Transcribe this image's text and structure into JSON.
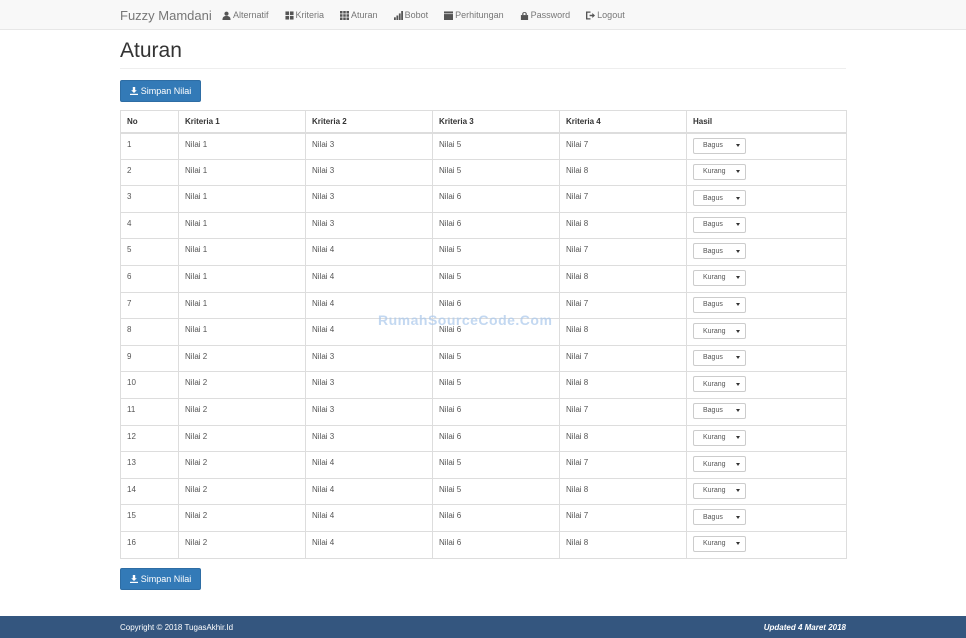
{
  "navbar": {
    "brand": "Fuzzy Mamdani",
    "items": [
      {
        "label": "Alternatif",
        "icon": "user-icon"
      },
      {
        "label": "Kriteria",
        "icon": "th-large-icon"
      },
      {
        "label": "Aturan",
        "icon": "th-icon"
      },
      {
        "label": "Bobot",
        "icon": "signal-icon"
      },
      {
        "label": "Perhitungan",
        "icon": "calendar-icon"
      },
      {
        "label": "Password",
        "icon": "lock-icon"
      },
      {
        "label": "Logout",
        "icon": "log-out-icon"
      }
    ]
  },
  "page": {
    "title": "Aturan"
  },
  "buttons": {
    "save_label": "Simpan Nilai"
  },
  "table": {
    "headers": [
      "No",
      "Kriteria 1",
      "Kriteria 2",
      "Kriteria 3",
      "Kriteria 4",
      "Hasil"
    ],
    "rows": [
      [
        "1",
        "Nilai 1",
        "Nilai 3",
        "Nilai 5",
        "Nilai 7",
        "Bagus"
      ],
      [
        "2",
        "Nilai 1",
        "Nilai 3",
        "Nilai 5",
        "Nilai 8",
        "Kurang"
      ],
      [
        "3",
        "Nilai 1",
        "Nilai 3",
        "Nilai 6",
        "Nilai 7",
        "Bagus"
      ],
      [
        "4",
        "Nilai 1",
        "Nilai 3",
        "Nilai 6",
        "Nilai 8",
        "Bagus"
      ],
      [
        "5",
        "Nilai 1",
        "Nilai 4",
        "Nilai 5",
        "Nilai 7",
        "Bagus"
      ],
      [
        "6",
        "Nilai 1",
        "Nilai 4",
        "Nilai 5",
        "Nilai 8",
        "Kurang"
      ],
      [
        "7",
        "Nilai 1",
        "Nilai 4",
        "Nilai 6",
        "Nilai 7",
        "Bagus"
      ],
      [
        "8",
        "Nilai 1",
        "Nilai 4",
        "Nilai 6",
        "Nilai 8",
        "Kurang"
      ],
      [
        "9",
        "Nilai 2",
        "Nilai 3",
        "Nilai 5",
        "Nilai 7",
        "Bagus"
      ],
      [
        "10",
        "Nilai 2",
        "Nilai 3",
        "Nilai 5",
        "Nilai 8",
        "Kurang"
      ],
      [
        "11",
        "Nilai 2",
        "Nilai 3",
        "Nilai 6",
        "Nilai 7",
        "Bagus"
      ],
      [
        "12",
        "Nilai 2",
        "Nilai 3",
        "Nilai 6",
        "Nilai 8",
        "Kurang"
      ],
      [
        "13",
        "Nilai 2",
        "Nilai 4",
        "Nilai 5",
        "Nilai 7",
        "Kurang"
      ],
      [
        "14",
        "Nilai 2",
        "Nilai 4",
        "Nilai 5",
        "Nilai 8",
        "Kurang"
      ],
      [
        "15",
        "Nilai 2",
        "Nilai 4",
        "Nilai 6",
        "Nilai 7",
        "Bagus"
      ],
      [
        "16",
        "Nilai 2",
        "Nilai 4",
        "Nilai 6",
        "Nilai 8",
        "Kurang"
      ]
    ]
  },
  "watermark": "RumahSourceCode.Com",
  "footer": {
    "copyright": "Copyright © 2018 TugasAkhir.Id",
    "updated": "Updated 4 Maret 2018"
  },
  "colors": {
    "primary": "#337ab7",
    "footer_bg": "#34567f",
    "navbar_bg": "#f8f8f8"
  }
}
